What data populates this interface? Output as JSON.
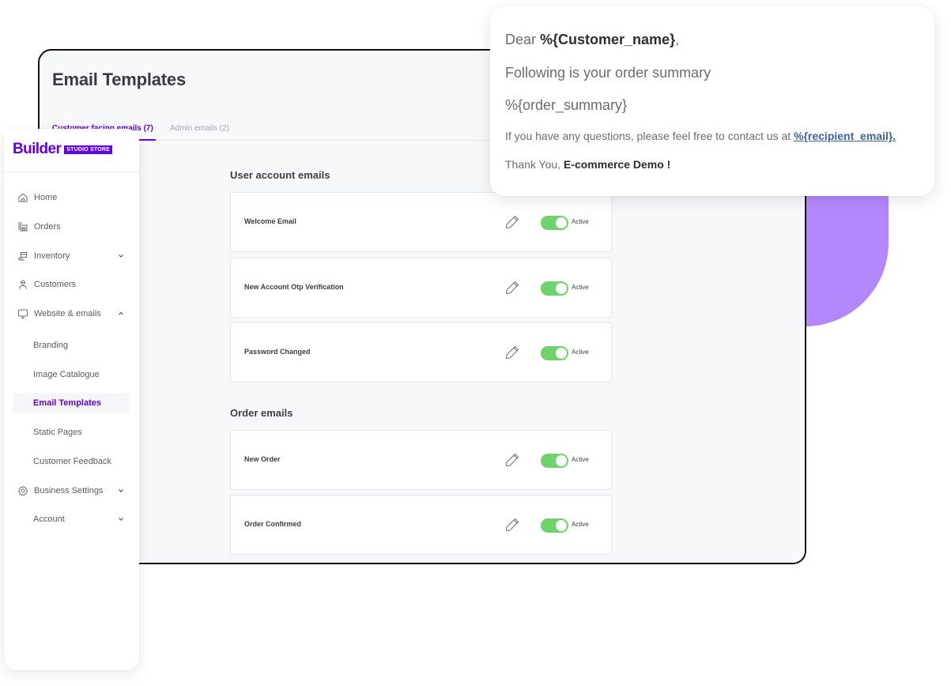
{
  "colors": {
    "accent": "#6200ea",
    "toggle_on": "#6dd36a",
    "decor_purple": "#b388fc",
    "link": "#3b63a8"
  },
  "page": {
    "title": "Email Templates",
    "tabs": [
      {
        "label": "Customer facing emails (7)",
        "active": true
      },
      {
        "label": "Admin emails (2)",
        "active": false
      }
    ]
  },
  "sections": [
    {
      "title": "User account emails",
      "templates": [
        {
          "name": "Welcome Email",
          "status": "Active",
          "enabled": true,
          "edit_icon": "pencil-icon"
        },
        {
          "name": "New Account Otp Verification",
          "status": "Active",
          "enabled": true,
          "edit_icon": "pencil-icon"
        },
        {
          "name": "Password Changed",
          "status": "Active",
          "enabled": true,
          "edit_icon": "pencil-icon"
        }
      ]
    },
    {
      "title": "Order emails",
      "templates": [
        {
          "name": "New Order",
          "status": "Active",
          "enabled": true,
          "edit_icon": "pencil-icon"
        },
        {
          "name": "Order Confirmed",
          "status": "Active",
          "enabled": true,
          "edit_icon": "pencil-icon"
        }
      ]
    }
  ],
  "sidebar": {
    "brand": {
      "logo": "Builder",
      "badge": "STUDIO STORE"
    },
    "items": [
      {
        "label": "Home",
        "icon": "home-icon"
      },
      {
        "label": "Orders",
        "icon": "orders-icon"
      },
      {
        "label": "Inventory",
        "icon": "inventory-icon",
        "chevron": "chevron-down-icon"
      },
      {
        "label": "Customers",
        "icon": "customers-icon"
      },
      {
        "label": "Website & emails",
        "icon": "monitor-icon",
        "chevron": "chevron-up-icon"
      },
      {
        "label": "Branding"
      },
      {
        "label": "Image Catalogue"
      },
      {
        "label": "Email Templates",
        "active": true
      },
      {
        "label": "Static Pages"
      },
      {
        "label": "Customer Feedback"
      },
      {
        "label": "Business Settings",
        "icon": "gear-icon",
        "chevron": "chevron-down-icon"
      },
      {
        "label": "Account",
        "chevron": "chevron-down-icon"
      }
    ]
  },
  "preview": {
    "line1_prefix": "Dear ",
    "line1_var": "%{Customer_name}",
    "line1_suffix": ",",
    "line2": "Following is your order summary",
    "line3": "%{order_summary}",
    "line4_prefix": "If you have any questions, please feel free to contact us at ",
    "line4_link": "%{recipient_email}.",
    "line5_prefix": "Thank You, ",
    "line5_bold": "E-commerce Demo !"
  }
}
